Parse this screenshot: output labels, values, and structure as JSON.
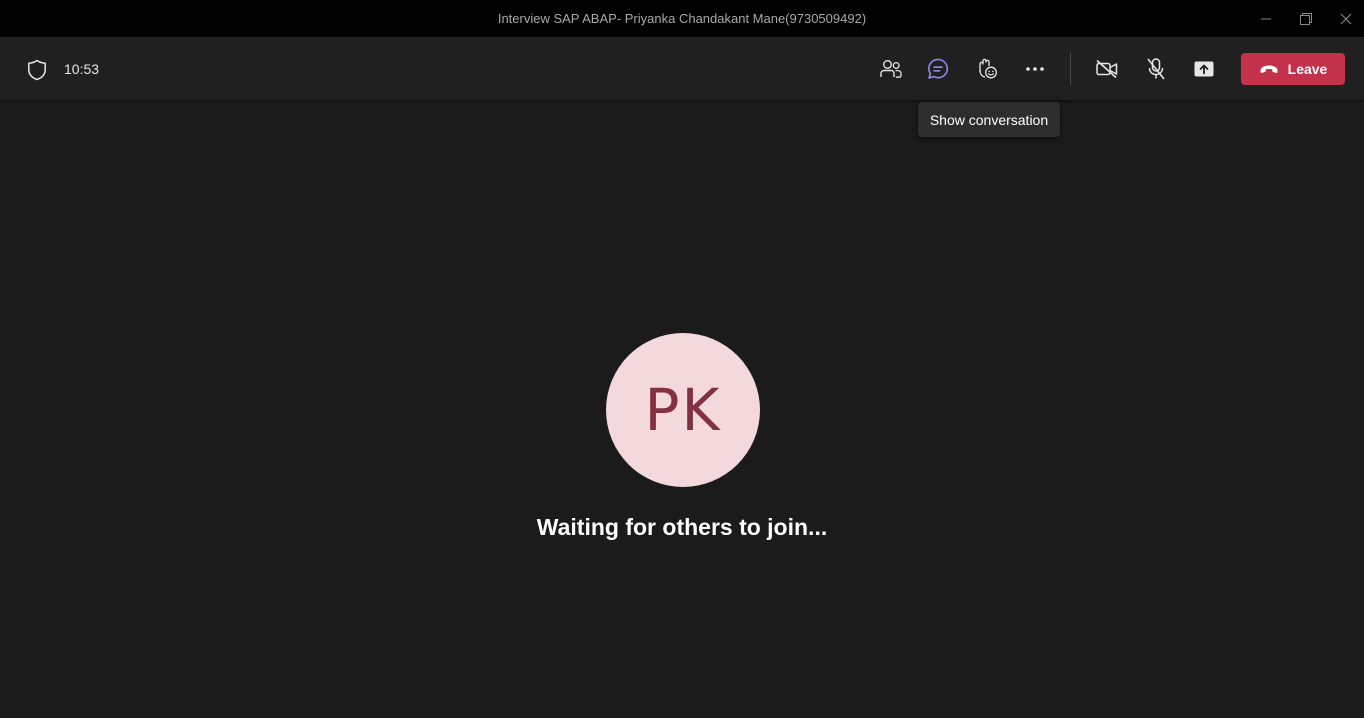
{
  "window": {
    "title": "Interview SAP ABAP- Priyanka Chandakant Mane(9730509492)",
    "controls": [
      "minimize-icon",
      "restore-icon",
      "close-icon"
    ]
  },
  "toolbar": {
    "security_icon": "shield-icon",
    "timer": "10:53",
    "buttons": [
      {
        "icon": "people-icon",
        "name": "participants"
      },
      {
        "icon": "chat-icon",
        "name": "conversation",
        "active": true
      },
      {
        "icon": "reactions-icon",
        "name": "reactions"
      },
      {
        "icon": "more-icon",
        "name": "more-actions"
      },
      {
        "icon": "camera-off-icon",
        "name": "camera"
      },
      {
        "icon": "mic-off-icon",
        "name": "microphone"
      },
      {
        "icon": "share-tray-icon",
        "name": "share-content"
      }
    ],
    "leave_label": "Leave",
    "leave_icon": "hang-up-icon"
  },
  "tooltip": {
    "text": "Show conversation"
  },
  "stage": {
    "avatar_initials": "PK",
    "waiting_message": "Waiting for others to join..."
  },
  "colors": {
    "titlebar_bg": "#000000",
    "toolbar_bg": "#202020",
    "stage_bg": "#1b1b1b",
    "accent": "#8b8cf0",
    "leave_bg": "#c4314b",
    "avatar_bg": "#f4d9dc",
    "avatar_text": "#81313f"
  }
}
